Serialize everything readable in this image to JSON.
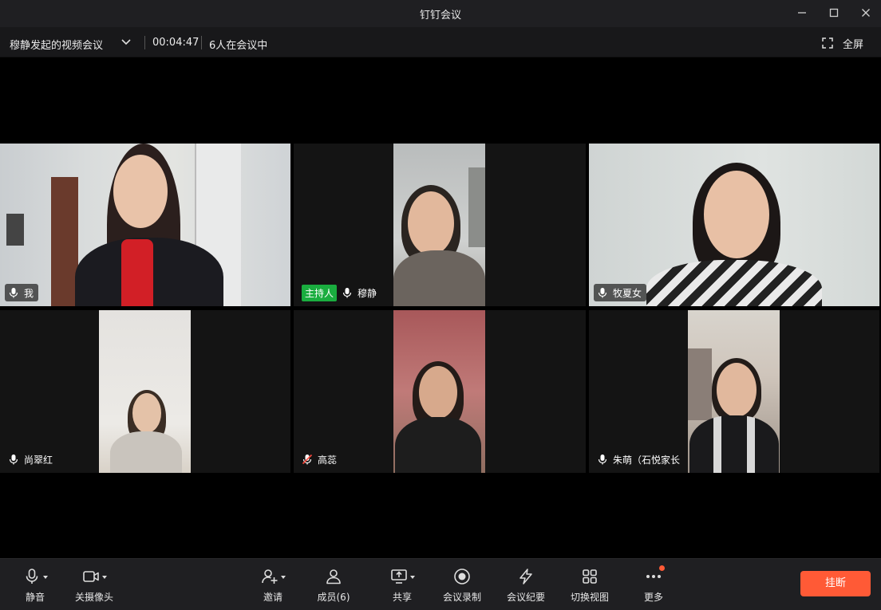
{
  "window": {
    "title": "钉钉会议",
    "minimize_icon": "minimize-icon",
    "maximize_icon": "maximize-icon",
    "close_icon": "close-icon"
  },
  "infobar": {
    "meeting_title": "穆静发起的视频会议",
    "timer": "00:04:47",
    "participants": "6人在会议中",
    "fullscreen_label": "全屏"
  },
  "tiles": [
    {
      "name": "我",
      "host": false,
      "muted": false,
      "mic_icon": "mic-icon"
    },
    {
      "name": "穆静",
      "host": true,
      "host_badge": "主持人",
      "muted": false,
      "mic_icon": "mic-icon"
    },
    {
      "name": "牧夏女",
      "host": false,
      "muted": false,
      "mic_icon": "mic-icon"
    },
    {
      "name": "尚翠红",
      "host": false,
      "muted": false,
      "mic_icon": "mic-icon"
    },
    {
      "name": "高蕊",
      "host": false,
      "muted": true,
      "mic_icon": "mic-muted-icon"
    },
    {
      "name": "朱萌（石悦家长",
      "host": false,
      "muted": false,
      "mic_icon": "mic-icon"
    }
  ],
  "toolbar": {
    "mute": "静音",
    "camera": "关摄像头",
    "invite": "邀请",
    "members": "成员(6)",
    "share": "共享",
    "record": "会议录制",
    "minutes": "会议纪要",
    "switch_view": "切换视图",
    "more": "更多",
    "hangup": "挂断"
  },
  "colors": {
    "host_badge": "#1aad3f",
    "hangup": "#ff5a36",
    "notification_dot": "#ff5a36"
  }
}
